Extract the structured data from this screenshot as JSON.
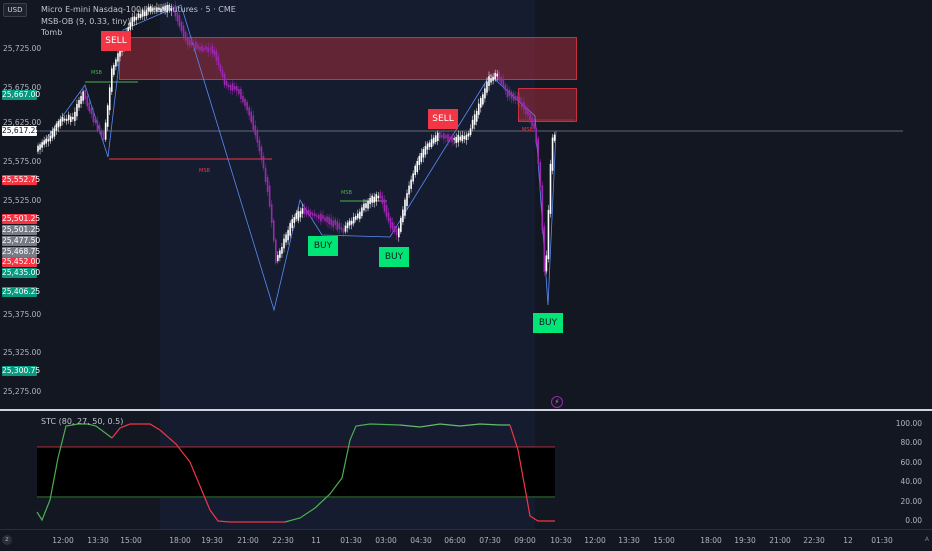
{
  "header": {
    "currency": "USD",
    "symbol_title": "Micro E-mini Nasdaq-100 Index Futures · 5 · CME",
    "indicator1": "MSB-OB (9, 0.33, tiny)",
    "indicator2": "Tomb"
  },
  "price_axis": [
    "25,725.00",
    "25,675.00",
    "25,625.00",
    "25,575.00",
    "25,525.00",
    "25,375.00",
    "25,325.00",
    "25,275.00"
  ],
  "price_badges": [
    {
      "text": "25,667.00",
      "color": "#089981"
    },
    {
      "text": "25,617.25",
      "color": "#ffffff"
    },
    {
      "text": "25,552.75",
      "color": "#f23645"
    },
    {
      "text": "25,501.25",
      "color": "#f23645"
    },
    {
      "text": "25,501.25",
      "color": "#787b86"
    },
    {
      "text": "25,477.50",
      "color": "#787b86"
    },
    {
      "text": "25,468.75",
      "color": "#787b86"
    },
    {
      "text": "25,452.00",
      "color": "#f23645"
    },
    {
      "text": "25,435.00",
      "color": "#089981"
    },
    {
      "text": "25,406.25",
      "color": "#089981"
    },
    {
      "text": "25,300.75",
      "color": "#089981"
    }
  ],
  "signals": {
    "sell": "SELL",
    "buy": "BUY",
    "msb": "MSB"
  },
  "oscillator": {
    "title": "STC (80, 27, 50, 0.5)",
    "axis": [
      "100.00",
      "80.00",
      "60.00",
      "40.00",
      "20.00",
      "0.00"
    ]
  },
  "time_axis": [
    "12:00",
    "13:30",
    "15:00",
    "18:00",
    "19:30",
    "21:00",
    "22:30",
    "11",
    "01:30",
    "03:00",
    "04:30",
    "06:00",
    "07:30",
    "09:00",
    "10:30",
    "12:00",
    "13:30",
    "15:00",
    "18:00",
    "19:30",
    "21:00",
    "22:30",
    "12",
    "01:30"
  ],
  "colors": {
    "bg": "#131722",
    "up": "#ffffff",
    "down": "#9c27b0",
    "sell": "#f23645",
    "buy": "#00e676",
    "zone": "#f2364533"
  }
}
